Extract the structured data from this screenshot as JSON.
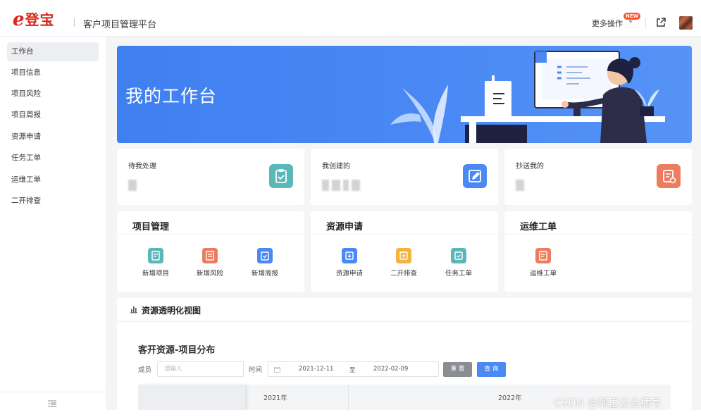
{
  "header": {
    "logo_mark": "e",
    "logo_text": "登宝",
    "platform_title": "客户项目管理平台",
    "more_ops_label": "更多操作",
    "new_badge": "NEW"
  },
  "sidebar": {
    "items": [
      {
        "label": "工作台",
        "active": true
      },
      {
        "label": "项目信息"
      },
      {
        "label": "项目风险"
      },
      {
        "label": "项目周报"
      },
      {
        "label": "资源申请"
      },
      {
        "label": "任务工单"
      },
      {
        "label": "运维工单"
      },
      {
        "label": "二开排查"
      }
    ]
  },
  "banner": {
    "title": "我的工作台"
  },
  "stats": [
    {
      "label": "待我处理",
      "icon": "clipboard-check-icon",
      "color": "#5bb8b8"
    },
    {
      "label": "我创建的",
      "icon": "edit-box-icon",
      "color": "#4a89f4"
    },
    {
      "label": "抄送我的",
      "icon": "document-cc-icon",
      "color": "#ee7c5f"
    }
  ],
  "groups": [
    {
      "title": "项目管理",
      "apps": [
        {
          "label": "新增项目",
          "color": "#5bb8b8"
        },
        {
          "label": "新增风险",
          "color": "#ee7c5f"
        },
        {
          "label": "新增周报",
          "color": "#4a89f4"
        }
      ]
    },
    {
      "title": "资源申请",
      "apps": [
        {
          "label": "资源申请",
          "color": "#4a89f4"
        },
        {
          "label": "二开排查",
          "color": "#f5b340"
        },
        {
          "label": "任务工单",
          "color": "#5bb8b8"
        }
      ]
    },
    {
      "title": "运维工单",
      "apps": [
        {
          "label": "运维工单",
          "color": "#ee7c5f"
        }
      ]
    }
  ],
  "view": {
    "title": "资源透明化视图",
    "subtitle": "客开资源-项目分布",
    "member_label": "成员",
    "member_placeholder": "请输入",
    "time_label": "时间",
    "date_start": "2021-12-11",
    "date_sep": "至",
    "date_end": "2022-02-09",
    "reset_label": "重 置",
    "query_label": "查 询",
    "years": [
      "2021年",
      "2022年"
    ]
  },
  "watermark": "CSDN @阿里云云栖号"
}
